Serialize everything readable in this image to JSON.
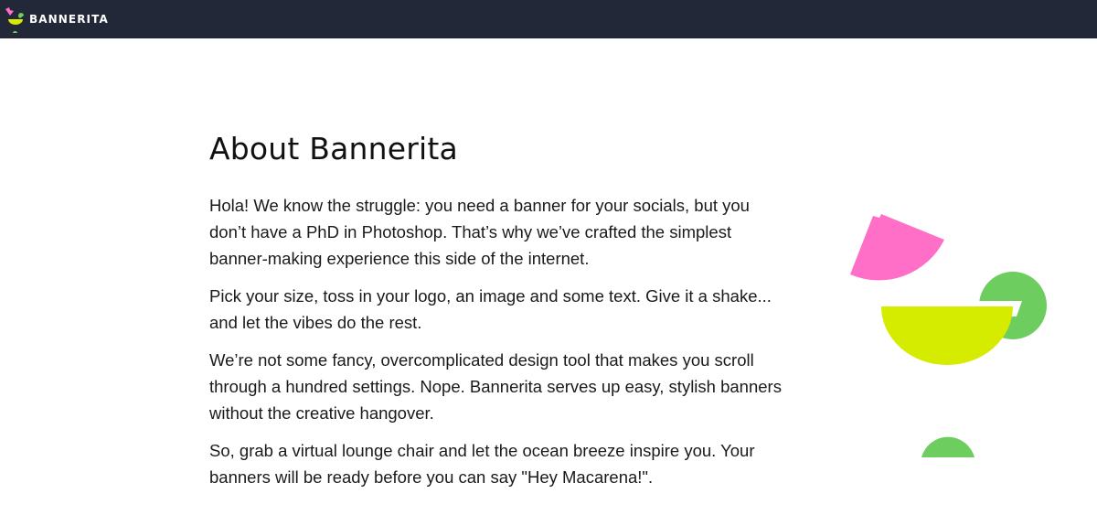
{
  "header": {
    "brand_name": "BANNERITA",
    "background_color": "#222838",
    "logo_icon": "cocktail-glass-icon"
  },
  "main": {
    "title": "About Bannerita",
    "paragraphs": [
      "Hola! We know the struggle: you need a banner for your socials, but you don’t have a PhD in Photoshop. That’s why we’ve crafted the simplest banner-making experience this side of the internet.",
      "Pick your size, toss in your logo, an image and some text. Give it a shake... and let the vibes do the rest.",
      "We’re not some fancy, overcomplicated design tool that makes you scroll through a hundred settings. Nope. Bannerita serves up easy, stylish banners without the creative hangover.",
      "So, grab a virtual lounge chair and let the ocean breeze inspire you. Your banners will be ready before you can say \"Hey Macarena!\"."
    ]
  },
  "illustration": {
    "icon": "cocktail-illustration",
    "colors": {
      "pink": "#ff6ec7",
      "lime": "#d5ec00",
      "green": "#6dcd5e"
    }
  }
}
